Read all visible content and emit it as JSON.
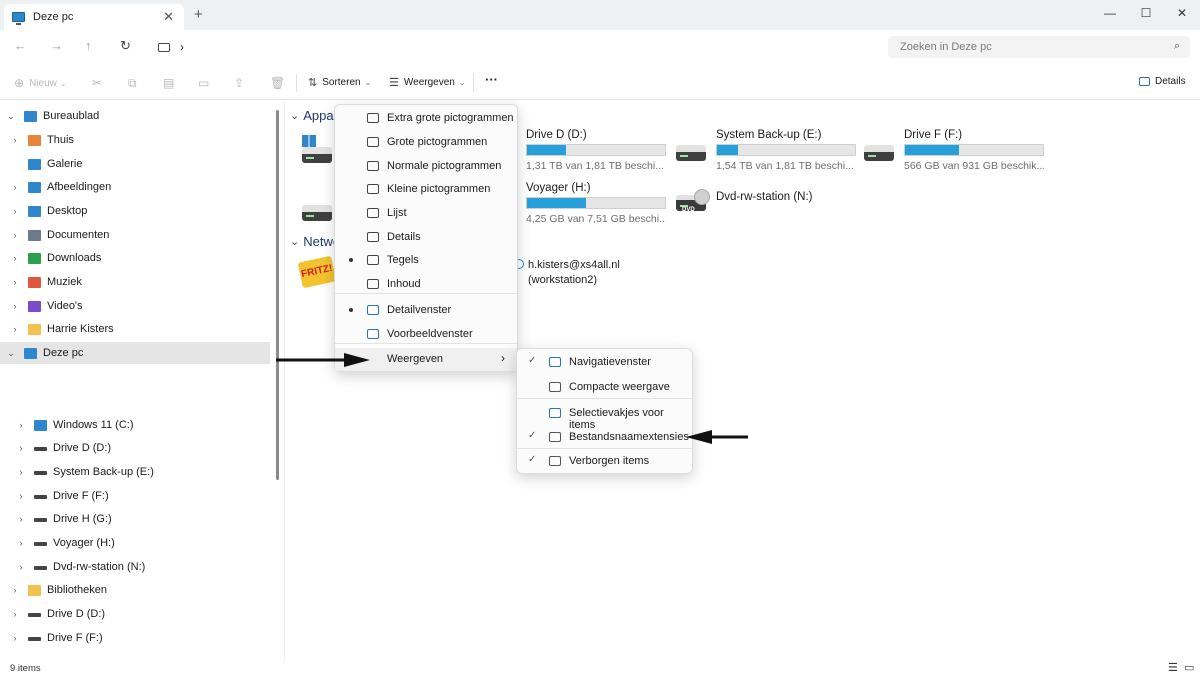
{
  "window": {
    "tab_title": "Deze pc",
    "tab_close": "✕",
    "new_tab": "+",
    "minimize": "—",
    "maximize": "☐",
    "close": "✕"
  },
  "address": {
    "chevron": "›",
    "search_placeholder": "Zoeken in Deze pc"
  },
  "toolbar": {
    "new_label": "Nieuw",
    "sort_label": "Sorteren",
    "view_label": "Weergeven",
    "more_label": "···",
    "details_label": "Details"
  },
  "sidebar": {
    "items": [
      {
        "label": "Bureaublad",
        "color": "#2f86cc"
      },
      {
        "label": "Thuis",
        "color": "#e8833a"
      },
      {
        "label": "Galerie",
        "color": "#2f86cc"
      },
      {
        "label": "Afbeeldingen",
        "color": "#2f86cc"
      },
      {
        "label": "Desktop",
        "color": "#2f86cc"
      },
      {
        "label": "Documenten",
        "color": "#6b7b8c"
      },
      {
        "label": "Downloads",
        "color": "#2f9e4f"
      },
      {
        "label": "Muziek",
        "color": "#e0573f"
      },
      {
        "label": "Video's",
        "color": "#7a4cc9"
      },
      {
        "label": "Harrie Kisters",
        "color": "#f2c14e"
      },
      {
        "label": "Deze pc",
        "color": "#2f86cc"
      },
      {
        "label": "Windows 11 (C:)",
        "color": "#2f86cc"
      },
      {
        "label": "Drive D (D:)",
        "color": "#444444"
      },
      {
        "label": "System Back-up (E:)",
        "color": "#444444"
      },
      {
        "label": "Drive F (F:)",
        "color": "#444444"
      },
      {
        "label": "Drive H (G:)",
        "color": "#444444"
      },
      {
        "label": "Voyager (H:)",
        "color": "#444444"
      },
      {
        "label": "Dvd-rw-station (N:)",
        "color": "#444444"
      },
      {
        "label": "Bibliotheken",
        "color": "#f2c14e"
      },
      {
        "label": "Drive D (D:)",
        "color": "#444444"
      },
      {
        "label": "Drive F (F:)",
        "color": "#444444"
      }
    ]
  },
  "content": {
    "group_devices": "Appar",
    "group_network": "Netwe",
    "drives": [
      {
        "name": "Drive D (D:)",
        "info": "1,31 TB van 1,81 TB beschi...",
        "fill": 0.28
      },
      {
        "name": "System Back-up (E:)",
        "info": "1,54 TB van 1,81 TB beschi...",
        "fill": 0.15
      },
      {
        "name": "Drive F (F:)",
        "info": "566 GB van 931 GB beschik...",
        "fill": 0.39
      },
      {
        "name": "Voyager (H:)",
        "info": "4,25 GB van 7,51 GB beschi...",
        "fill": 0.43
      }
    ],
    "dvd_name": "Dvd-rw-station (N:)",
    "dvd_tag": "DVD",
    "network_user": "h.kisters@xs4all.nl",
    "network_host": "(workstation2)"
  },
  "view_menu": {
    "items": [
      "Extra grote pictogrammen",
      "Grote pictogrammen",
      "Normale pictogrammen",
      "Kleine pictogrammen",
      "Lijst",
      "Details",
      "Tegels",
      "Inhoud",
      "Detailvenster",
      "Voorbeeldvenster",
      "Weergeven"
    ],
    "submenu_chevron": "›"
  },
  "show_menu": {
    "items": [
      "Navigatievenster",
      "Compacte weergave",
      "Selectievakjes voor items",
      "Bestandsnaamextensies",
      "Verborgen items"
    ],
    "check": "✓"
  },
  "status": {
    "items_count": "9 items"
  }
}
